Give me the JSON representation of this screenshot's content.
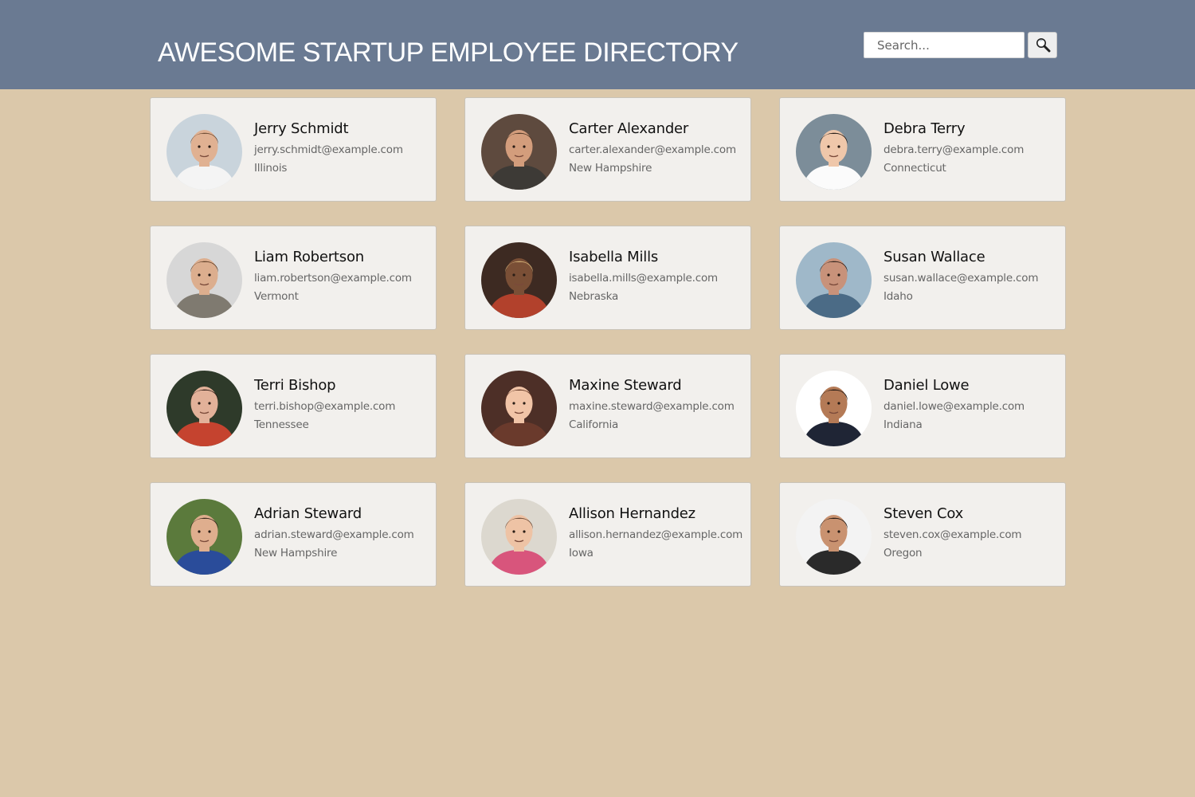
{
  "header": {
    "title": "AWESOME STARTUP EMPLOYEE DIRECTORY"
  },
  "search": {
    "placeholder": "Search...",
    "button_icon": "magnifier-icon"
  },
  "colors": {
    "header_bg": "#6a7a92",
    "page_bg": "#dbc8aa",
    "card_bg": "#f2f0ed",
    "card_border": "#c9c3b8",
    "title_text": "#ffffff",
    "name_text": "#111111",
    "detail_text": "#666666"
  },
  "employees": [
    {
      "name": "Jerry Schmidt",
      "email": "jerry.schmidt@example.com",
      "location": "Illinois",
      "photo": {
        "bg": "#c9d4dc",
        "skin": "#e0b192",
        "hair": "#6b4a33",
        "shirt": "#f4f4f4"
      }
    },
    {
      "name": "Carter Alexander",
      "email": "carter.alexander@example.com",
      "location": "New Hampshire",
      "photo": {
        "bg": "#5e4a3e",
        "skin": "#d39d7c",
        "hair": "#4a3323",
        "shirt": "#3d3a36"
      }
    },
    {
      "name": "Debra Terry",
      "email": "debra.terry@example.com",
      "location": "Connecticut",
      "photo": {
        "bg": "#7c8d99",
        "skin": "#efc7aa",
        "hair": "#1b1410",
        "shirt": "#fbfbfb"
      }
    },
    {
      "name": "Liam Robertson",
      "email": "liam.robertson@example.com",
      "location": "Vermont",
      "photo": {
        "bg": "#d7d7d7",
        "skin": "#dcae8e",
        "hair": "#5b3b24",
        "shirt": "#7f7a70"
      }
    },
    {
      "name": "Isabella Mills",
      "email": "isabella.mills@example.com",
      "location": "Nebraska",
      "photo": {
        "bg": "#3d2a22",
        "skin": "#7a4f36",
        "hair": "#d5b47a",
        "shirt": "#b2412c"
      }
    },
    {
      "name": "Susan Wallace",
      "email": "susan.wallace@example.com",
      "location": "Idaho",
      "photo": {
        "bg": "#9fb8c9",
        "skin": "#c8927a",
        "hair": "#2a1f1a",
        "shirt": "#4b6b86"
      }
    },
    {
      "name": "Terri Bishop",
      "email": "terri.bishop@example.com",
      "location": "Tennessee",
      "photo": {
        "bg": "#2e3a2a",
        "skin": "#e2b199",
        "hair": "#2b1812",
        "shirt": "#c5432f"
      }
    },
    {
      "name": "Maxine Steward",
      "email": "maxine.steward@example.com",
      "location": "California",
      "photo": {
        "bg": "#4d2f27",
        "skin": "#f1c4a7",
        "hair": "#5a2f1e",
        "shirt": "#6a3a2c"
      }
    },
    {
      "name": "Daniel Lowe",
      "email": "daniel.lowe@example.com",
      "location": "Indiana",
      "photo": {
        "bg": "#ffffff",
        "skin": "#b47a56",
        "hair": "#1a1410",
        "shirt": "#1f2535"
      }
    },
    {
      "name": "Adrian Steward",
      "email": "adrian.steward@example.com",
      "location": "New Hampshire",
      "photo": {
        "bg": "#5b7a3c",
        "skin": "#dfae8e",
        "hair": "#2f2218",
        "shirt": "#2a4c9a"
      }
    },
    {
      "name": "Allison Hernandez",
      "email": "allison.hernandez@example.com",
      "location": "Iowa",
      "photo": {
        "bg": "#dcd8cf",
        "skin": "#eec3a5",
        "hair": "#6b4a36",
        "shirt": "#d8557c"
      }
    },
    {
      "name": "Steven Cox",
      "email": "steven.cox@example.com",
      "location": "Oregon",
      "photo": {
        "bg": "#f3f3f3",
        "skin": "#c99270",
        "hair": "#1c1511",
        "shirt": "#2a2a2a"
      }
    }
  ]
}
